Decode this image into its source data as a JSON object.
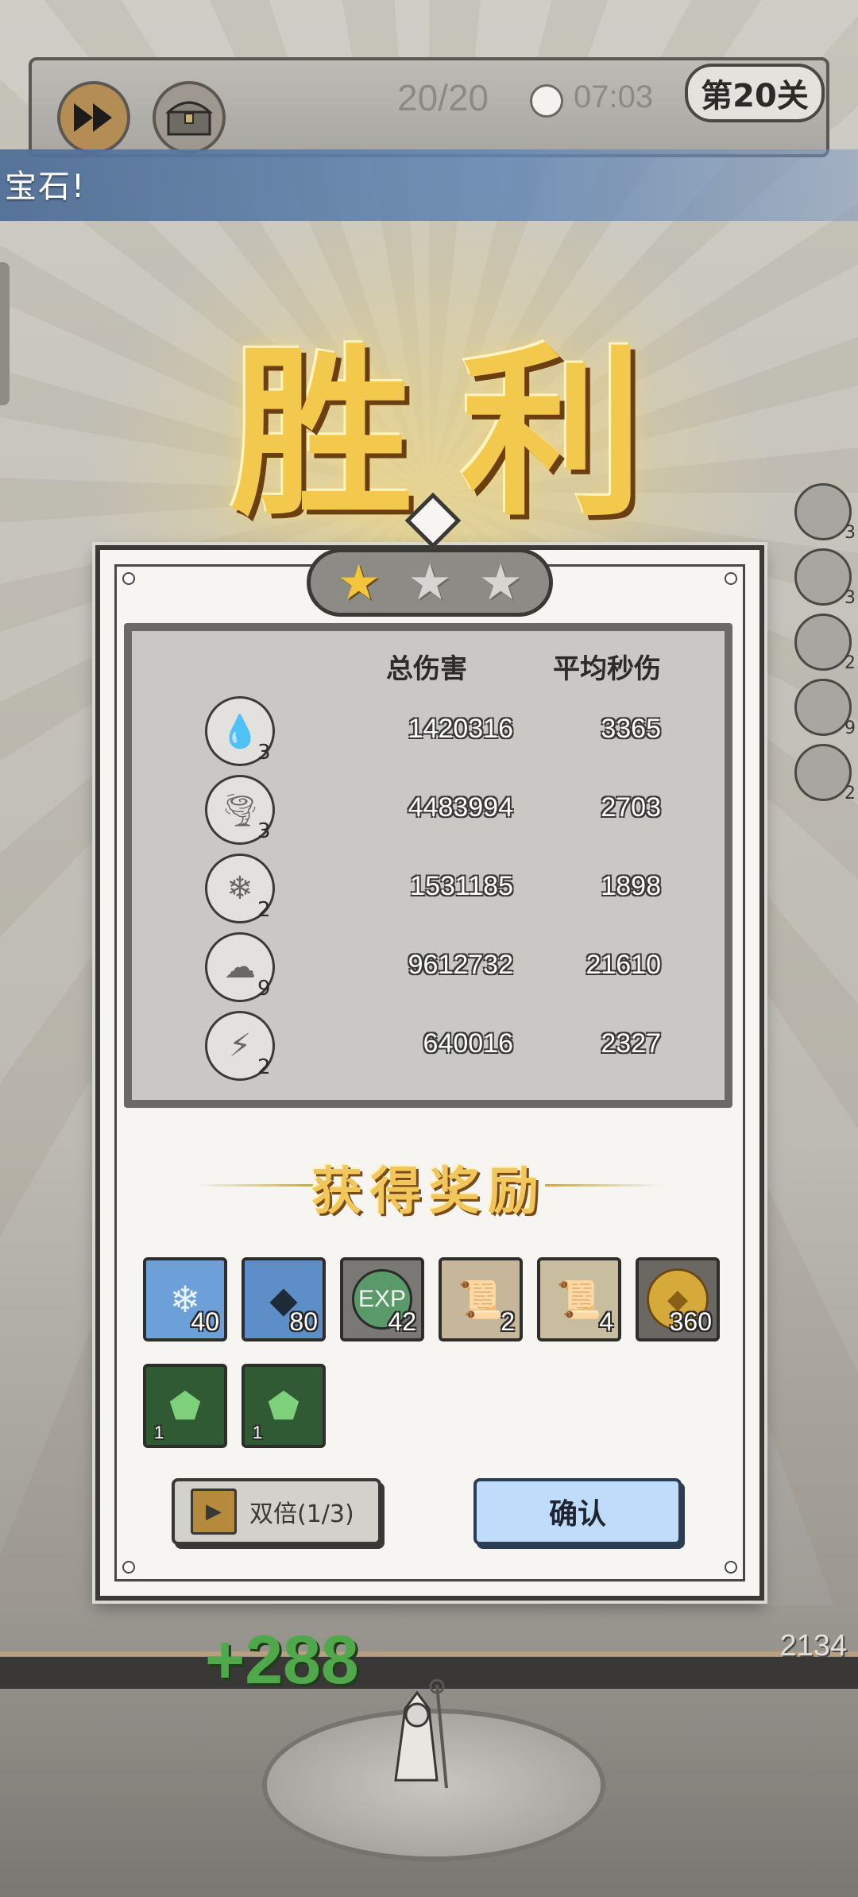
{
  "hud": {
    "wave": "20/20",
    "timer": "07:03",
    "level": "第20关",
    "icons": [
      "fast-forward-icon",
      "chest-icon",
      "clock-icon"
    ]
  },
  "notice": {
    "text": "宝石!"
  },
  "victory": {
    "title": "胜利"
  },
  "side_skills": [
    {
      "level": "3"
    },
    {
      "level": "3"
    },
    {
      "level": "2"
    },
    {
      "level": "9"
    },
    {
      "level": "2"
    }
  ],
  "result": {
    "stars_earned": 1,
    "stars_total": 3,
    "headers": {
      "total_damage": "总伤害",
      "avg_dps": "平均秒伤"
    },
    "skills": [
      {
        "icon": "water-drop-icon",
        "level": "3",
        "total_damage": "1420316",
        "avg_dps": "3365"
      },
      {
        "icon": "tornado-icon",
        "level": "3",
        "total_damage": "4483994",
        "avg_dps": "2703"
      },
      {
        "icon": "crystal-icon",
        "level": "2",
        "total_damage": "1531185",
        "avg_dps": "1898"
      },
      {
        "icon": "lightning-storm-icon",
        "level": "9",
        "total_damage": "9612732",
        "avg_dps": "21610"
      },
      {
        "icon": "lightning-bolt-icon",
        "level": "2",
        "total_damage": "640016",
        "avg_dps": "2327"
      }
    ]
  },
  "rewards": {
    "title": "获得奖励",
    "items": [
      {
        "icon": "ice-crystal-icon",
        "count": "40"
      },
      {
        "icon": "dark-crystal-icon",
        "count": "80"
      },
      {
        "icon": "exp-icon",
        "label": "EXP",
        "count": "42"
      },
      {
        "icon": "scroll-icon",
        "count": "2"
      },
      {
        "icon": "scroll-rare-icon",
        "count": "4"
      },
      {
        "icon": "gold-coin-icon",
        "count": "360"
      },
      {
        "icon": "green-gem-icon",
        "count": "1"
      },
      {
        "icon": "green-gem-icon",
        "count": "1"
      }
    ]
  },
  "buttons": {
    "double": "双倍(1/3)",
    "confirm": "确认"
  },
  "bottom": {
    "gain": "+288",
    "score": "2134"
  },
  "colors": {
    "gold": "#f2c94c",
    "confirm_blue": "#bfdcfb",
    "gain_green": "#4fa84a"
  }
}
